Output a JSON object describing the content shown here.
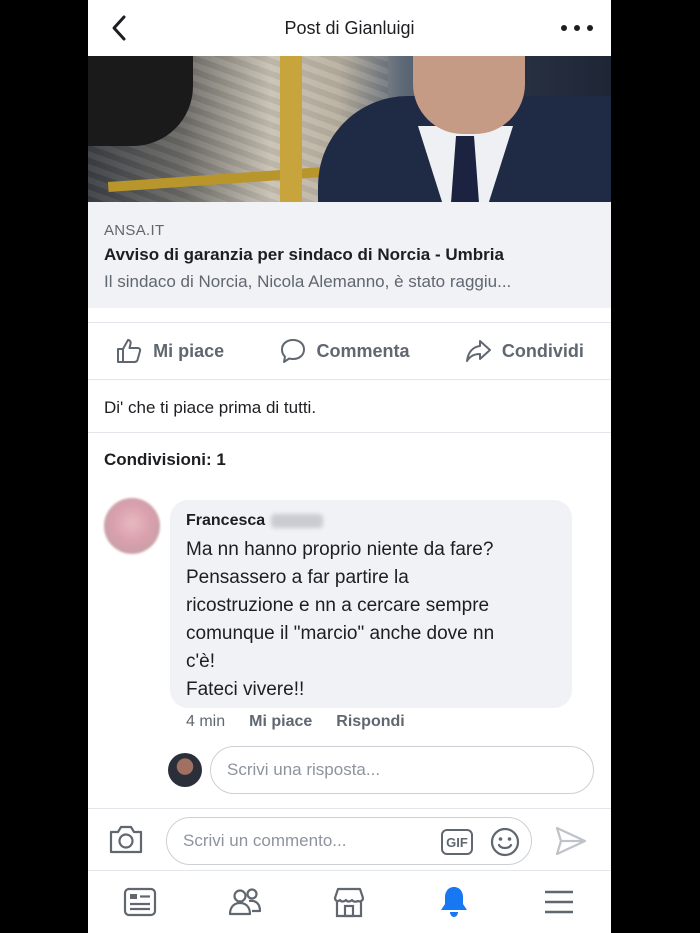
{
  "header": {
    "title": "Post di Gianluigi"
  },
  "link_preview": {
    "source": "ANSA.IT",
    "title": "Avviso di garanzia per sindaco di Norcia - Umbria",
    "description": "Il sindaco di Norcia, Nicola Alemanno, è stato raggiu..."
  },
  "actions": {
    "like": "Mi piace",
    "comment": "Commenta",
    "share": "Condividi"
  },
  "like_first": "Di' che ti piace prima di tutti.",
  "shares": "Condivisioni: 1",
  "comment": {
    "author": "Francesca",
    "lines": [
      "Ma nn hanno proprio niente da fare?",
      "Pensassero a far partire la",
      "ricostruzione e nn a cercare sempre",
      "comunque il \"marcio\" anche dove nn",
      "c'è!",
      "Fateci vivere!!"
    ],
    "time": "4 min",
    "like": "Mi piace",
    "reply": "Rispondi"
  },
  "reply_input": {
    "placeholder": "Scrivi una risposta..."
  },
  "composer": {
    "placeholder": "Scrivi un commento...",
    "gif": "GIF"
  },
  "colors": {
    "accent": "#1877f2",
    "muted": "#606770",
    "bubble": "#f0f2f5"
  },
  "icons": [
    "back-icon",
    "more-icon",
    "like-icon",
    "comment-icon",
    "share-icon",
    "camera-icon",
    "gif-icon",
    "emoji-icon",
    "send-icon",
    "news-feed-icon",
    "friends-icon",
    "marketplace-icon",
    "notifications-icon",
    "menu-icon"
  ]
}
